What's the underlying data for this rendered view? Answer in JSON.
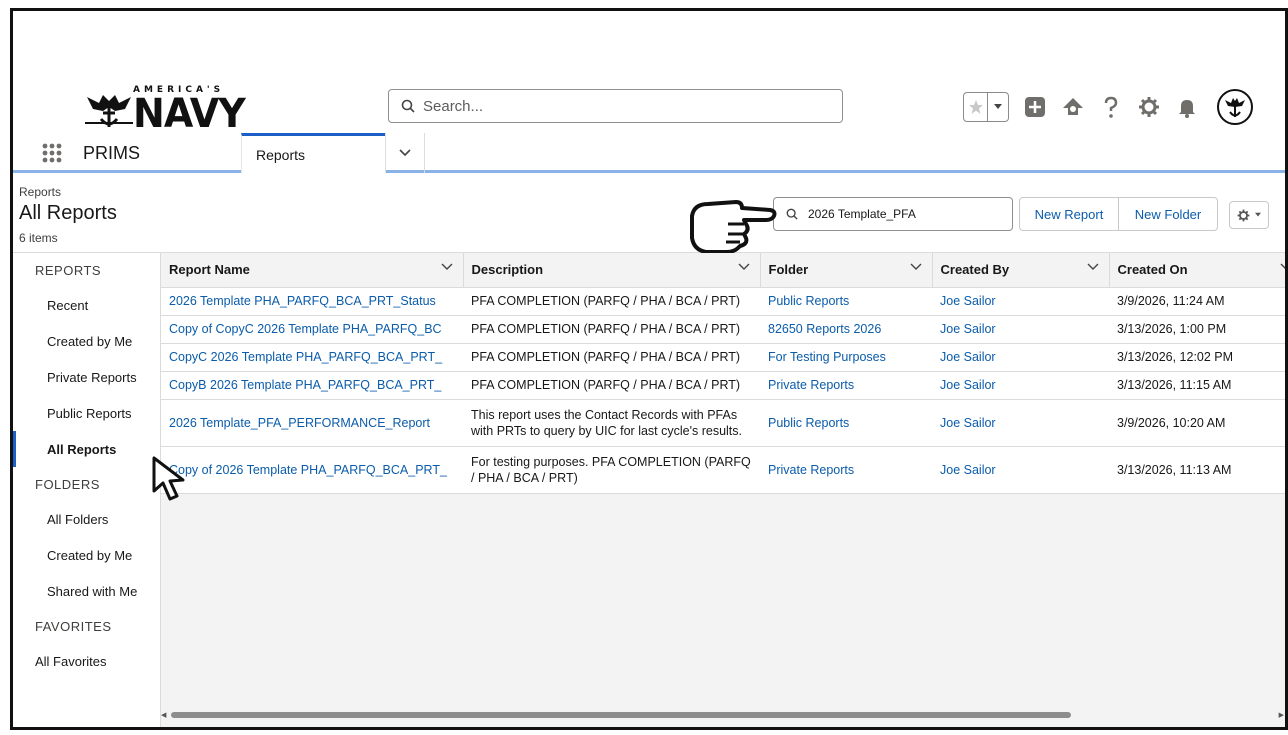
{
  "header": {
    "brand_top": "AMERICA'S",
    "brand_main": "NAVY",
    "search_placeholder": "Search..."
  },
  "nav": {
    "app_name": "PRIMS",
    "active_tab": "Reports"
  },
  "page": {
    "breadcrumb": "Reports",
    "title": "All Reports",
    "item_count": "6 items",
    "search_value": "2026 Template_PFA",
    "new_report": "New Report",
    "new_folder": "New Folder"
  },
  "sidebar": {
    "reports_header": "REPORTS",
    "reports_items": [
      "Recent",
      "Created by Me",
      "Private Reports",
      "Public Reports",
      "All Reports"
    ],
    "folders_header": "FOLDERS",
    "folder_items": [
      "All Folders",
      "Created by Me",
      "Shared with Me"
    ],
    "favorites_header": "FAVORITES",
    "favorite_items": [
      "All Favorites"
    ]
  },
  "table": {
    "columns": [
      "Report Name",
      "Description",
      "Folder",
      "Created By",
      "Created On"
    ],
    "rows": [
      {
        "name": "2026 Template PHA_PARFQ_BCA_PRT_Status",
        "description": "PFA COMPLETION (PARFQ / PHA / BCA / PRT)",
        "folder": "Public Reports",
        "created_by": "Joe Sailor",
        "created_on": "3/9/2026, 11:24 AM"
      },
      {
        "name": "Copy of CopyC 2026 Template PHA_PARFQ_BC",
        "description": "PFA COMPLETION (PARFQ / PHA / BCA / PRT)",
        "folder": "82650 Reports 2026",
        "created_by": "Joe Sailor",
        "created_on": "3/13/2026, 1:00 PM"
      },
      {
        "name": "CopyC 2026 Template PHA_PARFQ_BCA_PRT_",
        "description": "PFA COMPLETION (PARFQ / PHA / BCA / PRT)",
        "folder": "For Testing Purposes",
        "created_by": "Joe Sailor",
        "created_on": "3/13/2026, 12:02 PM"
      },
      {
        "name": "CopyB 2026 Template PHA_PARFQ_BCA_PRT_",
        "description": "PFA COMPLETION (PARFQ / PHA / BCA / PRT)",
        "folder": "Private Reports",
        "created_by": "Joe Sailor",
        "created_on": "3/13/2026, 11:15 AM"
      },
      {
        "name": "2026 Template_PFA_PERFORMANCE_Report",
        "description": "This report uses the Contact Records with PFAs with PRTs to query by UIC for last cycle's results.",
        "folder": "Public Reports",
        "created_by": "Joe Sailor",
        "created_on": "3/9/2026, 10:20 AM"
      },
      {
        "name": "Copy of 2026 Template PHA_PARFQ_BCA_PRT_",
        "description": "For testing purposes. PFA COMPLETION (PARFQ / PHA / BCA / PRT)",
        "folder": "Private Reports",
        "created_by": "Joe Sailor",
        "created_on": "3/13/2026, 11:13 AM"
      }
    ]
  },
  "colors": {
    "link": "#0b5cab",
    "accent": "#1b5fc7"
  }
}
